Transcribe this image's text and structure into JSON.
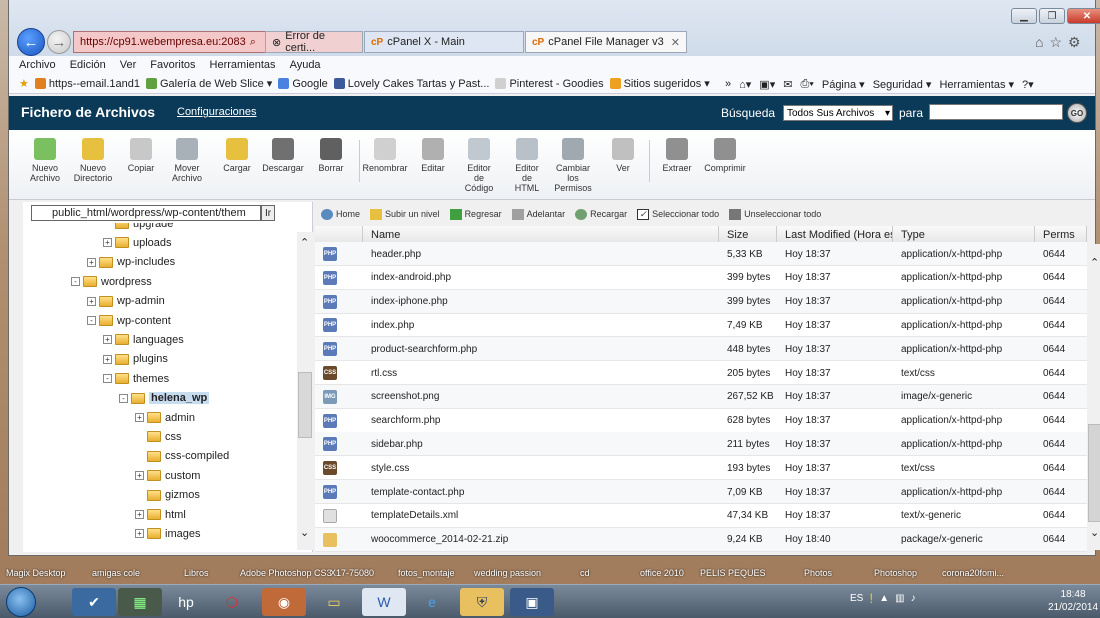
{
  "browser": {
    "address": "https://cp91.webempresa.eu:2083",
    "cert_tab": "Error de certi...",
    "tabs": [
      "cPanel X - Main",
      "cPanel File Manager v3"
    ],
    "tab_prefix": "cP",
    "menu": [
      "Archivo",
      "Edición",
      "Ver",
      "Favoritos",
      "Herramientas",
      "Ayuda"
    ],
    "favorites": [
      "https--email.1and1",
      "Galería de Web Slice ▾",
      "Google",
      "Lovely Cakes Tartas y Past...",
      "Pinterest - Goodies",
      "Sitios sugeridos ▾"
    ],
    "cmd": [
      "Página ▾",
      "Seguridad ▾",
      "Herramientas ▾"
    ]
  },
  "cpanel": {
    "title": "Fichero de Archivos",
    "config": "Configuraciones",
    "search_label": "Búsqueda",
    "search_select": "Todos Sus Archivos",
    "para": "para",
    "go": "GO"
  },
  "toolbar": [
    {
      "label": "Nuevo Archivo",
      "icon": "new-file-icon",
      "color": "#7ac060"
    },
    {
      "label": "Nuevo Directorio",
      "icon": "new-folder-icon",
      "color": "#e8c040"
    },
    {
      "label": "Copiar",
      "icon": "copy-icon",
      "color": "#c8c8c8"
    },
    {
      "label": "Mover Archivo",
      "icon": "move-icon",
      "color": "#a8b0b8"
    },
    {
      "label": "Cargar",
      "icon": "upload-icon",
      "color": "#e8c040"
    },
    {
      "label": "Descargar",
      "icon": "download-icon",
      "color": "#707070"
    },
    {
      "label": "Borrar",
      "icon": "delete-icon",
      "color": "#606060"
    },
    {
      "label": "Renombrar",
      "icon": "rename-icon",
      "color": "#d0d0d0"
    },
    {
      "label": "Editar",
      "icon": "edit-icon",
      "color": "#b0b0b0"
    },
    {
      "label": "Editor de Código",
      "icon": "code-editor-icon",
      "color": "#c0c8d0"
    },
    {
      "label": "Editor de HTML",
      "icon": "html-editor-icon",
      "color": "#b8c0c8"
    },
    {
      "label": "Cambiar los Permisos",
      "icon": "permissions-icon",
      "color": "#a0a8b0"
    },
    {
      "label": "Ver",
      "icon": "view-icon",
      "color": "#c0c0c0"
    },
    {
      "label": "Extraer",
      "icon": "extract-icon",
      "color": "#909090"
    },
    {
      "label": "Comprimir",
      "icon": "compress-icon",
      "color": "#909090"
    }
  ],
  "path": "public_html/wordpress/wp-content/them",
  "path_btn": "Ir",
  "tree": [
    {
      "label": "upgrade",
      "level": 2,
      "exp": ""
    },
    {
      "label": "uploads",
      "level": 2,
      "exp": "+"
    },
    {
      "label": "wp-includes",
      "level": 1,
      "exp": "+"
    },
    {
      "label": "wordpress",
      "level": 0,
      "exp": "-"
    },
    {
      "label": "wp-admin",
      "level": 1,
      "exp": "+"
    },
    {
      "label": "wp-content",
      "level": 1,
      "exp": "-"
    },
    {
      "label": "languages",
      "level": 2,
      "exp": "+"
    },
    {
      "label": "plugins",
      "level": 2,
      "exp": "+"
    },
    {
      "label": "themes",
      "level": 2,
      "exp": "-"
    },
    {
      "label": "helena_wp",
      "level": 3,
      "exp": "-",
      "selected": true
    },
    {
      "label": "admin",
      "level": 4,
      "exp": "+"
    },
    {
      "label": "css",
      "level": 4,
      "exp": ""
    },
    {
      "label": "css-compiled",
      "level": 4,
      "exp": ""
    },
    {
      "label": "custom",
      "level": 4,
      "exp": "+"
    },
    {
      "label": "gizmos",
      "level": 4,
      "exp": ""
    },
    {
      "label": "html",
      "level": 4,
      "exp": "+"
    },
    {
      "label": "images",
      "level": 4,
      "exp": "+"
    }
  ],
  "nav": [
    "Home",
    "Subir un nivel",
    "Regresar",
    "Adelantar",
    "Recargar",
    "Seleccionar todo",
    "Unseleccionar todo"
  ],
  "columns": [
    "Name",
    "Size",
    "Last Modified (Hora está",
    "Type",
    "Perms"
  ],
  "files": [
    {
      "name": "header.php",
      "size": "5,33 KB",
      "mod": "Hoy 18:37",
      "type": "application/x-httpd-php",
      "perms": "0644",
      "kind": "php"
    },
    {
      "name": "index-android.php",
      "size": "399 bytes",
      "mod": "Hoy 18:37",
      "type": "application/x-httpd-php",
      "perms": "0644",
      "kind": "php"
    },
    {
      "name": "index-iphone.php",
      "size": "399 bytes",
      "mod": "Hoy 18:37",
      "type": "application/x-httpd-php",
      "perms": "0644",
      "kind": "php"
    },
    {
      "name": "index.php",
      "size": "7,49 KB",
      "mod": "Hoy 18:37",
      "type": "application/x-httpd-php",
      "perms": "0644",
      "kind": "php"
    },
    {
      "name": "product-searchform.php",
      "size": "448 bytes",
      "mod": "Hoy 18:37",
      "type": "application/x-httpd-php",
      "perms": "0644",
      "kind": "php"
    },
    {
      "name": "rtl.css",
      "size": "205 bytes",
      "mod": "Hoy 18:37",
      "type": "text/css",
      "perms": "0644",
      "kind": "css"
    },
    {
      "name": "screenshot.png",
      "size": "267,52 KB",
      "mod": "Hoy 18:37",
      "type": "image/x-generic",
      "perms": "0644",
      "kind": "png"
    },
    {
      "name": "searchform.php",
      "size": "628 bytes",
      "mod": "Hoy 18:37",
      "type": "application/x-httpd-php",
      "perms": "0644",
      "kind": "php"
    },
    {
      "name": "sidebar.php",
      "size": "211 bytes",
      "mod": "Hoy 18:37",
      "type": "application/x-httpd-php",
      "perms": "0644",
      "kind": "php"
    },
    {
      "name": "style.css",
      "size": "193 bytes",
      "mod": "Hoy 18:37",
      "type": "text/css",
      "perms": "0644",
      "kind": "css"
    },
    {
      "name": "template-contact.php",
      "size": "7,09 KB",
      "mod": "Hoy 18:37",
      "type": "application/x-httpd-php",
      "perms": "0644",
      "kind": "php"
    },
    {
      "name": "templateDetails.xml",
      "size": "47,34 KB",
      "mod": "Hoy 18:37",
      "type": "text/x-generic",
      "perms": "0644",
      "kind": "xml"
    },
    {
      "name": "woocommerce_2014-02-21.zip",
      "size": "9,24 KB",
      "mod": "Hoy 18:40",
      "type": "package/x-generic",
      "perms": "0644",
      "kind": "zip"
    }
  ],
  "desktop_labels": [
    "Magix Desktop",
    "amigas cole",
    "Libros",
    "Adobe Photoshop CS3",
    "X17-75080",
    "fotos_montaje",
    "wedding passion",
    "cd",
    "office 2010",
    "PELIS PEQUES",
    "Photos",
    "Photoshop",
    "corona20fomi..."
  ],
  "tray": {
    "lang": "ES",
    "time": "18:48",
    "date": "21/02/2014"
  }
}
